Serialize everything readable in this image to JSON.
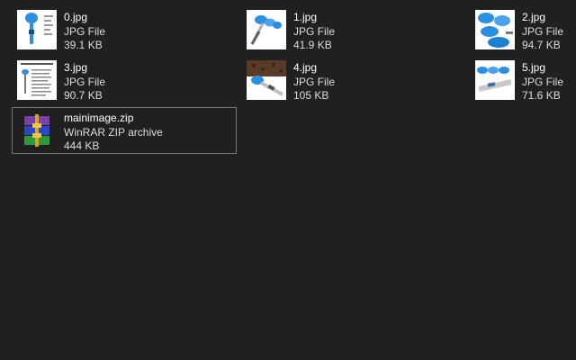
{
  "files": [
    {
      "name": "0.jpg",
      "type": "JPG File",
      "size": "39.1 KB",
      "icon": "scoop-scale-product-thumbnail"
    },
    {
      "name": "1.jpg",
      "type": "JPG File",
      "size": "41.9 KB",
      "icon": "blue-measuring-spoons-thumbnail"
    },
    {
      "name": "2.jpg",
      "type": "JPG File",
      "size": "94.7 KB",
      "icon": "blue-scoop-set-thumbnail"
    },
    {
      "name": "3.jpg",
      "type": "JPG File",
      "size": "90.7 KB",
      "icon": "instruction-sheet-thumbnail"
    },
    {
      "name": "4.jpg",
      "type": "JPG File",
      "size": "105 KB",
      "icon": "coffee-scoop-thumbnail"
    },
    {
      "name": "5.jpg",
      "type": "JPG File",
      "size": "71.6 KB",
      "icon": "digital-spoon-set-thumbnail"
    },
    {
      "name": "mainimage.zip",
      "type": "WinRAR ZIP archive",
      "size": "444 KB",
      "icon": "winrar-archive-icon"
    }
  ],
  "colors": {
    "background": "#202020",
    "selection_border": "#777777",
    "accent_blue": "#2d8fe0"
  }
}
